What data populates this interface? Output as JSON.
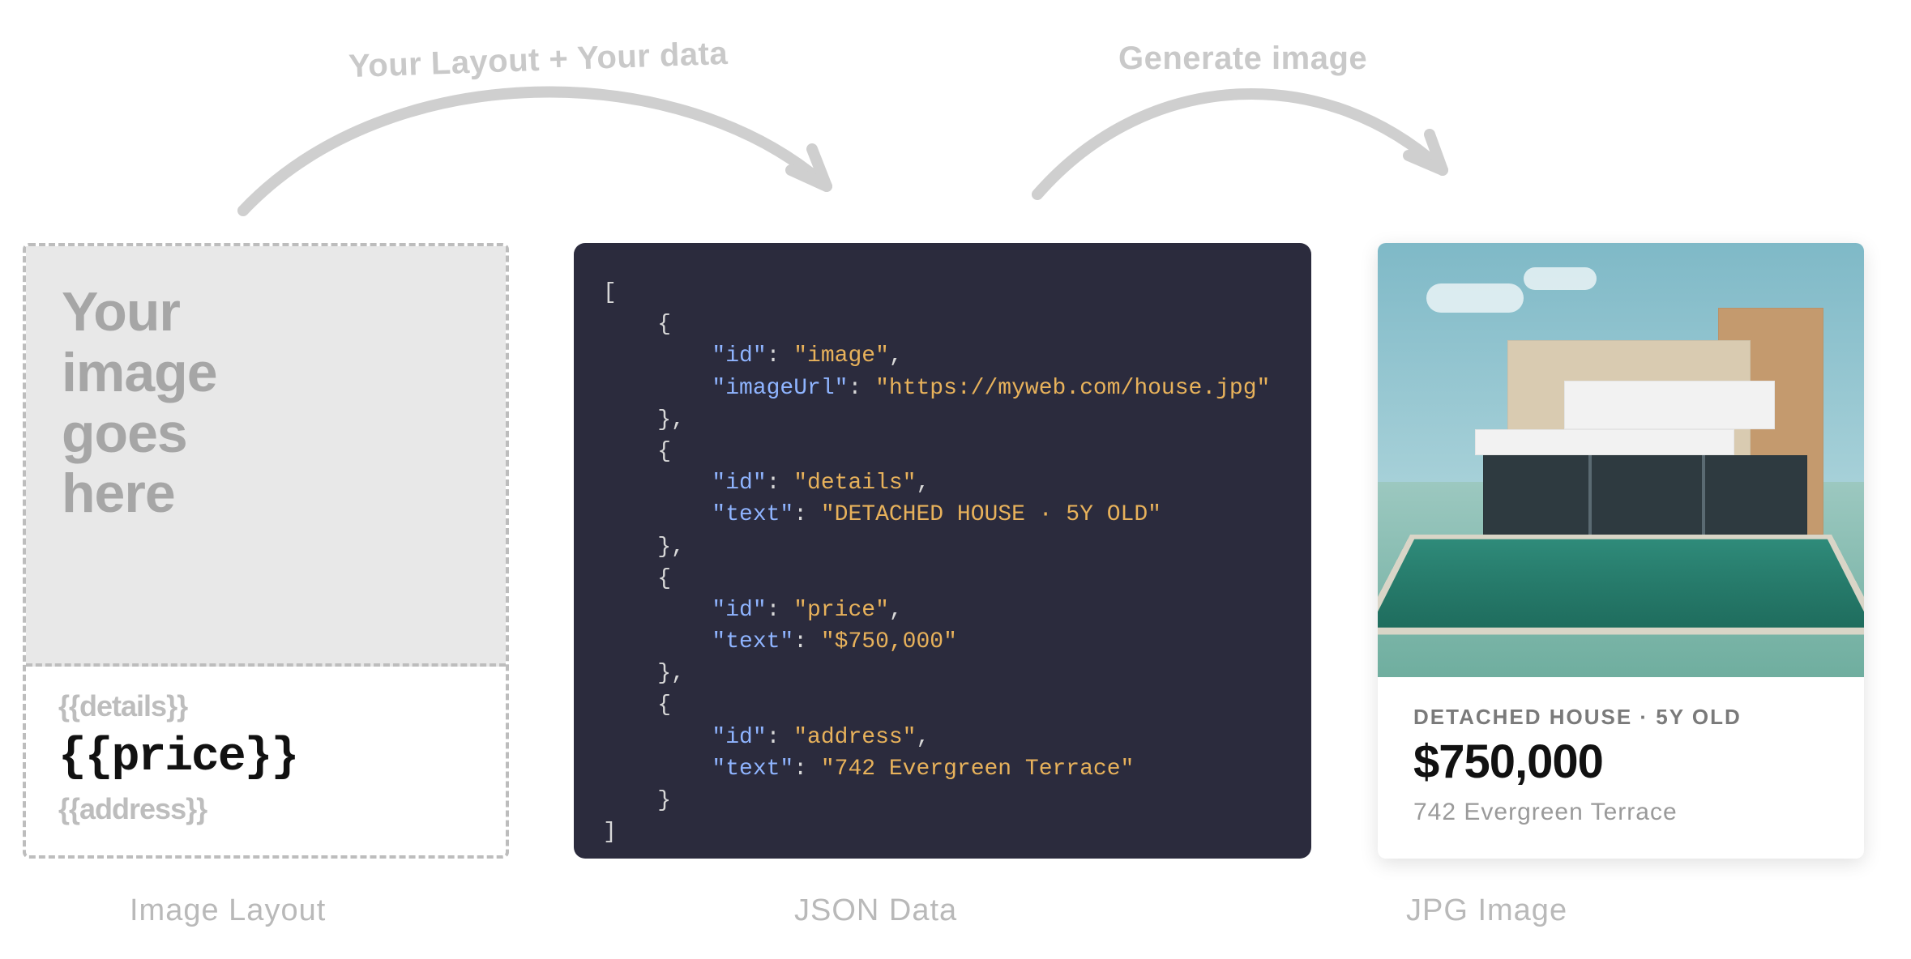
{
  "arcs": {
    "left_label": "Your Layout + Your data",
    "right_label": "Generate image"
  },
  "captions": {
    "layout": "Image Layout",
    "json": "JSON Data",
    "result": "JPG Image"
  },
  "layout_card": {
    "image_placeholder_text": "Your image goes here",
    "details_placeholder": "{{details}}",
    "price_placeholder": "{{price}}",
    "address_placeholder": "{{address}}"
  },
  "json_data": [
    {
      "id": "image",
      "imageUrl": "https://myweb.com/house.jpg"
    },
    {
      "id": "details",
      "text": "DETACHED HOUSE · 5Y OLD"
    },
    {
      "id": "price",
      "text": "$750,000"
    },
    {
      "id": "address",
      "text": "742 Evergreen Terrace"
    }
  ],
  "result_card": {
    "details": "DETACHED HOUSE  ·  5Y OLD",
    "price": "$750,000",
    "address": "742 Evergreen Terrace"
  },
  "colors": {
    "code_bg": "#2b2b3d",
    "key": "#8fb4ff",
    "string": "#e8b25b",
    "muted": "#b9b9b9"
  }
}
